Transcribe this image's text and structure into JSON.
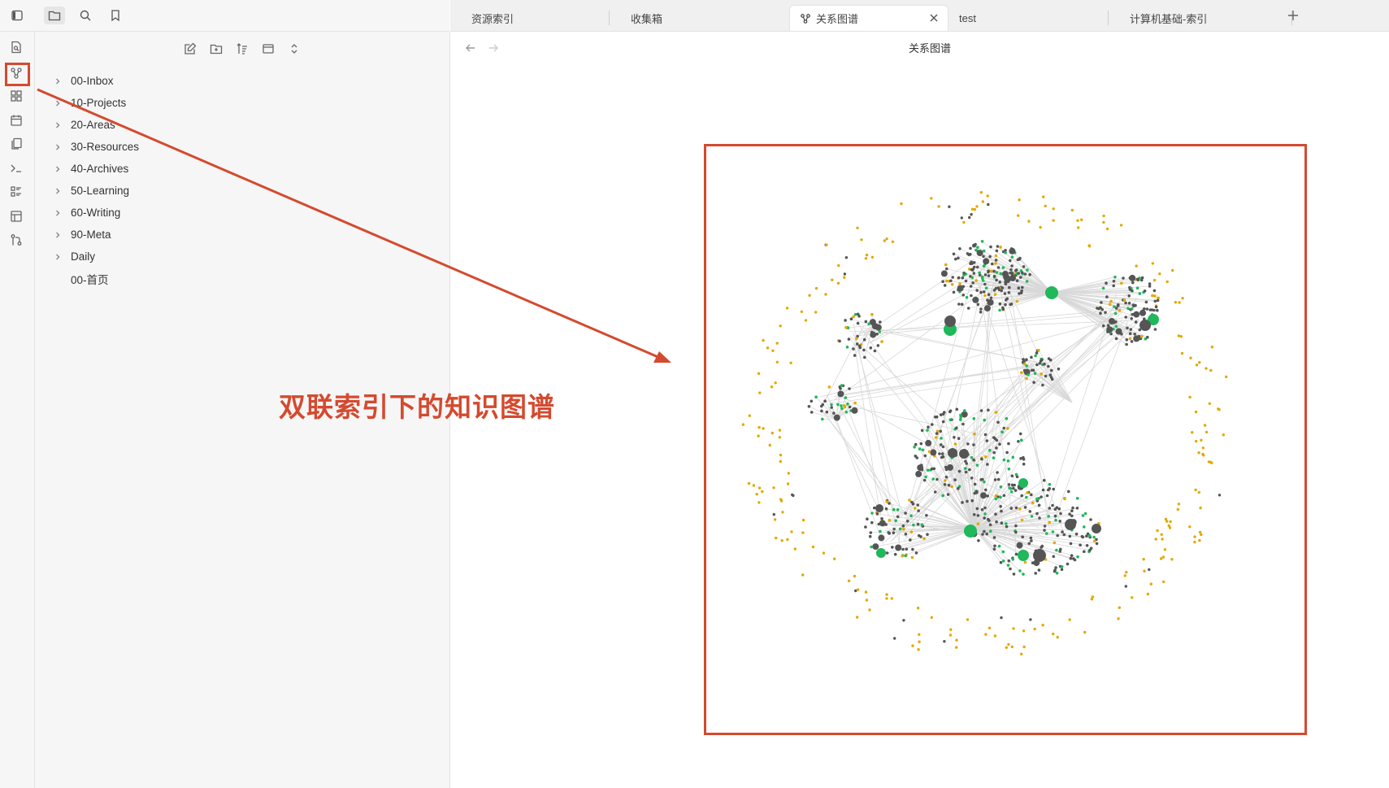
{
  "ribbon": {
    "items": [
      {
        "name": "open-quick-switcher-icon"
      },
      {
        "name": "graph-view-icon"
      },
      {
        "name": "canvas-icon"
      },
      {
        "name": "daily-note-calendar-icon"
      },
      {
        "name": "templates-icon"
      },
      {
        "name": "command-palette-icon"
      },
      {
        "name": "outline-icon"
      },
      {
        "name": "table-icon"
      },
      {
        "name": "git-icon"
      }
    ]
  },
  "sidebar": {
    "top_icons": [
      "toggle-sidebar-icon",
      "file-explorer-icon",
      "search-icon",
      "bookmark-icon"
    ],
    "actions": [
      "new-note-icon",
      "new-folder-icon",
      "sort-icon",
      "collapse-view-icon",
      "expand-all-icon"
    ],
    "tree": [
      {
        "label": "00-Inbox",
        "folder": true
      },
      {
        "label": "10-Projects",
        "folder": true
      },
      {
        "label": "20-Areas",
        "folder": true
      },
      {
        "label": "30-Resources",
        "folder": true
      },
      {
        "label": "40-Archives",
        "folder": true
      },
      {
        "label": "50-Learning",
        "folder": true
      },
      {
        "label": "60-Writing",
        "folder": true
      },
      {
        "label": "90-Meta",
        "folder": true
      },
      {
        "label": "Daily",
        "folder": true
      },
      {
        "label": "00-首页",
        "folder": false
      }
    ]
  },
  "tabs": [
    {
      "label": "资源索引"
    },
    {
      "label": "收集箱"
    },
    {
      "label": "关系图谱",
      "active": true
    },
    {
      "label": "test"
    },
    {
      "label": "计算机基础-索引"
    }
  ],
  "main": {
    "title": "关系图谱"
  },
  "annotation": {
    "text": "双联索引下的知识图谱",
    "color": "#d44a2f"
  },
  "graph": {
    "colors": {
      "dark": "#555555",
      "green": "#1fb85a",
      "orange": "#e3a800",
      "edge": "#d8d8d8"
    }
  }
}
